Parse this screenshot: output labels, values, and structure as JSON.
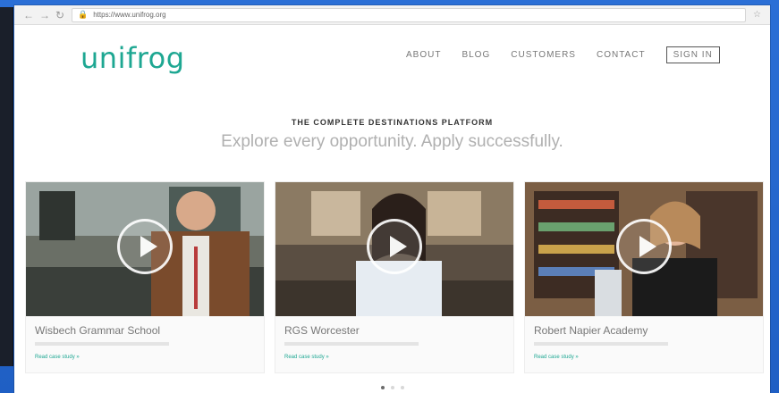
{
  "browser": {
    "back_icon": "back-icon",
    "forward_icon": "forward-icon",
    "reload_icon": "reload-icon",
    "lock_icon": "lock-icon",
    "url": "https://www.unifrog.org",
    "star_icon": "star-icon"
  },
  "site": {
    "logo": "unifrog",
    "nav": {
      "about": "ABOUT",
      "blog": "BLOG",
      "customers": "CUSTOMERS",
      "contact": "CONTACT",
      "sign_in": "SIGN IN"
    },
    "hero": {
      "eyebrow": "THE COMPLETE DESTINATIONS PLATFORM",
      "headline": "Explore every opportunity. Apply successfully."
    },
    "cards": [
      {
        "title": "Wisbech Grammar School",
        "link": "Read case study »"
      },
      {
        "title": "RGS Worcester",
        "link": "Read case study »"
      },
      {
        "title": "Robert Napier Academy",
        "link": "Read case study »"
      }
    ],
    "carousel": {
      "active_index": 0,
      "dots": 3
    }
  },
  "colors": {
    "brand": "#1ea792",
    "frame": "#1f63c9"
  }
}
